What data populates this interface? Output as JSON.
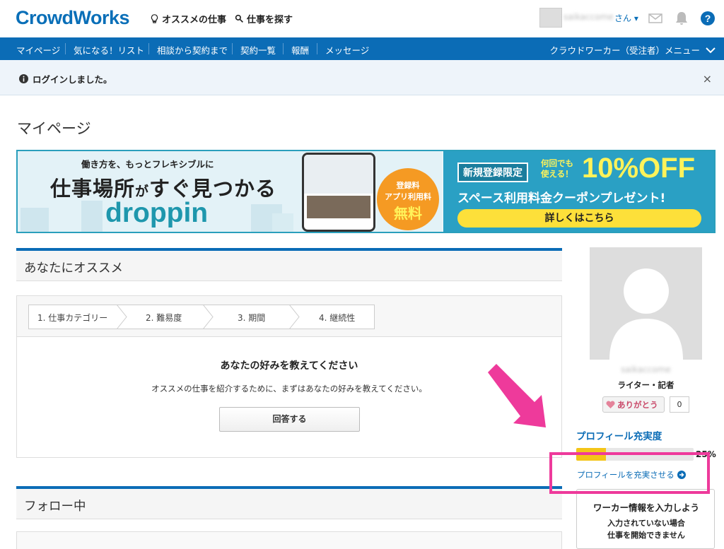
{
  "header": {
    "logo": "CrowdWorks",
    "recommended_jobs": "オススメの仕事",
    "find_jobs": "仕事を探す",
    "username": "saikaccome",
    "san": "さん"
  },
  "nav": {
    "items": [
      "マイページ",
      "気になる！リスト",
      "相談から契約まで",
      "契約一覧",
      "報酬",
      "メッセージ"
    ],
    "right_menu": "クラウドワーカー（受注者）メニュー"
  },
  "notice": {
    "text": "ログインしました。",
    "close": "×"
  },
  "page_title": "マイページ",
  "banner": {
    "small": "働き方を、もっとフレキシブルに",
    "big_a": "仕事場所",
    "big_b": "が",
    "big_c": "すぐ見つかる",
    "brand": "droppin",
    "badge_1": "登録料",
    "badge_2": "アプリ利用料",
    "badge_3": "無料",
    "tag": "新規登録限定",
    "anytime_1": "何回でも",
    "anytime_2": "使える！",
    "discount": "10%OFF",
    "coupon": "スペース利用料金クーポンプレゼント!",
    "cta": "詳しくはこちら"
  },
  "recommend": {
    "section_title": "あなたにオススメ",
    "steps": [
      "1. 仕事カテゴリー",
      "2. 難易度",
      "3. 期間",
      "4. 継続性"
    ],
    "question_title": "あなたの好みを教えてください",
    "question_sub": "オススメの仕事を紹介するために、まずはあなたの好みを教えてください。",
    "answer_button": "回答する"
  },
  "following": {
    "section_title": "フォロー中"
  },
  "profile": {
    "name": "saikaccome",
    "role": "ライター・記者",
    "thanks_label": "ありがとう",
    "thanks_count": "0",
    "completeness_title": "プロフィール充実度",
    "completeness_percent": 25,
    "completeness_label": "25%",
    "improve_link": "プロフィールを充実させる",
    "worker_info_title": "ワーカー情報を入力しよう",
    "worker_info_sub1": "入力されていない場合",
    "worker_info_sub2": "仕事を開始できません"
  },
  "colors": {
    "brand_blue": "#0b6cb6",
    "highlight_pink": "#ee3a9b",
    "progress_yellow": "#f4c518"
  }
}
